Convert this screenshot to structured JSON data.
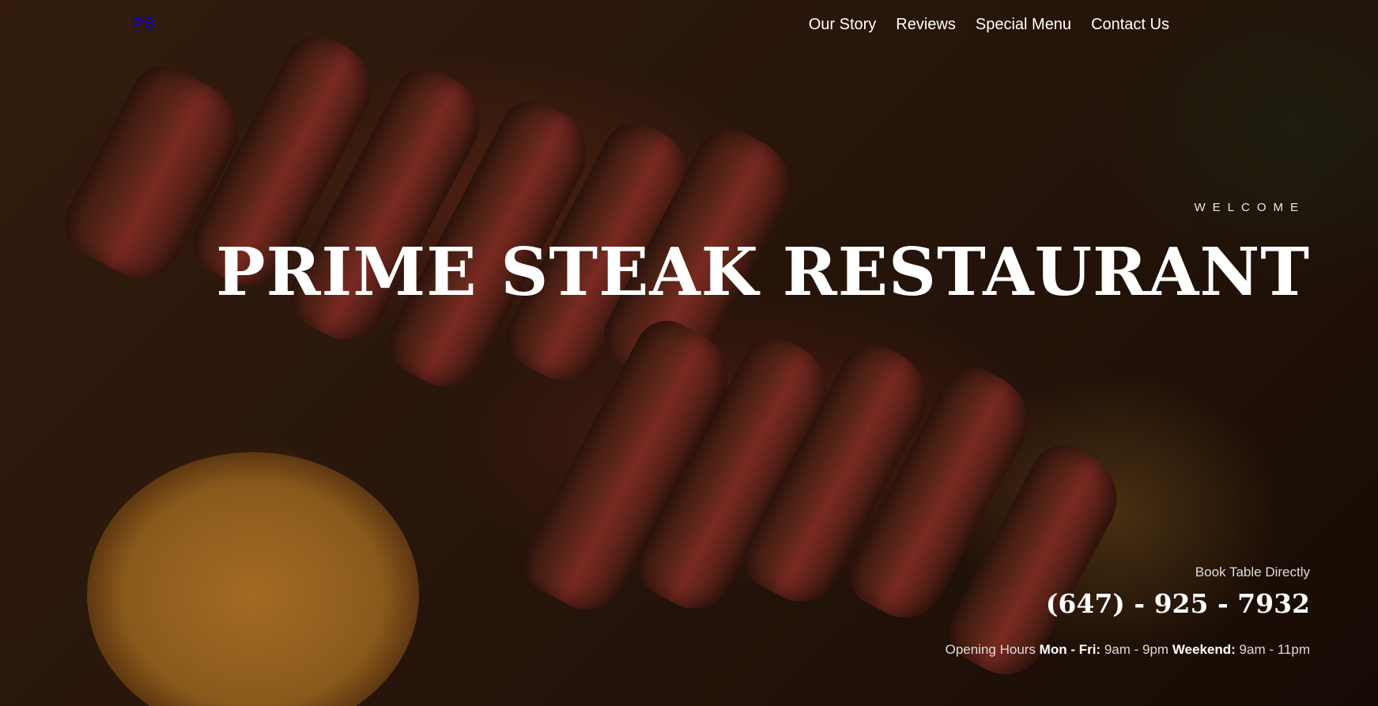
{
  "brand": {
    "logo": "PS"
  },
  "nav": {
    "items": [
      {
        "label": "Our Story"
      },
      {
        "label": "Reviews"
      },
      {
        "label": "Special Menu"
      },
      {
        "label": "Contact Us"
      }
    ]
  },
  "hero": {
    "eyebrow": "WELCOME",
    "title": "PRIME STEAK RESTAURANT",
    "background_image": "steak-on-cutting-board"
  },
  "booking": {
    "label": "Book Table Directly",
    "phone": "(647) - 925 - 7932"
  },
  "hours": {
    "label": "Opening Hours",
    "weekday_label": "Mon - Fri:",
    "weekday_time": "9am - 9pm",
    "weekend_label": "Weekend:",
    "weekend_time": "9am - 11pm"
  },
  "colors": {
    "text": "#ffffff",
    "muted_text": "#dcdcdc",
    "overlay": "#1a0d07"
  }
}
